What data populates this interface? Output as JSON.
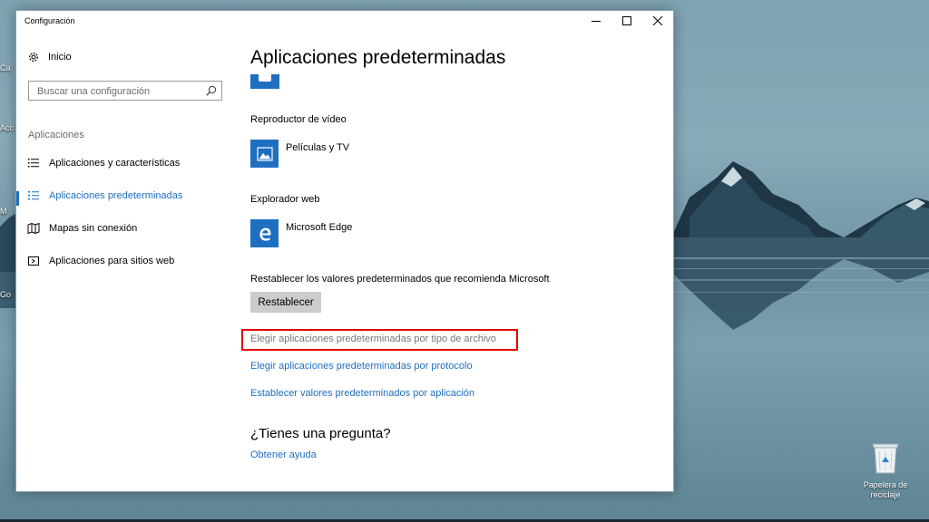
{
  "window": {
    "title": "Configuración"
  },
  "sidebar": {
    "home_label": "Inicio",
    "search_placeholder": "Buscar una configuración",
    "section_label": "Aplicaciones",
    "items": [
      {
        "label": "Aplicaciones y características",
        "icon": "list-icon",
        "selected": false
      },
      {
        "label": "Aplicaciones predeterminadas",
        "icon": "default-apps-icon",
        "selected": true
      },
      {
        "label": "Mapas sin conexión",
        "icon": "map-icon",
        "selected": false
      },
      {
        "label": "Aplicaciones para sitios web",
        "icon": "web-app-icon",
        "selected": false
      }
    ]
  },
  "main": {
    "title": "Aplicaciones predeterminadas",
    "video_player": {
      "label": "Reproductor de vídeo",
      "app": "Películas y TV",
      "icon": "movies-tv-icon"
    },
    "web_browser": {
      "label": "Explorador web",
      "app": "Microsoft Edge",
      "icon": "edge-icon"
    },
    "reset": {
      "label": "Restablecer los valores predeterminados que recomienda Microsoft",
      "button": "Restablecer"
    },
    "links": [
      "Elegir aplicaciones predeterminadas por tipo de archivo",
      "Elegir aplicaciones predeterminadas por protocolo",
      "Establecer valores predeterminados por aplicación"
    ],
    "question": {
      "title": "¿Tienes una pregunta?",
      "link": "Obtener ayuda"
    }
  },
  "desktop": {
    "recycle_bin_label": "Papelera de reciclaje",
    "edge_labels": [
      "Ca",
      "Acc",
      "M",
      "Go"
    ]
  },
  "colors": {
    "accent": "#1f6fc0",
    "highlight": "#e10000"
  }
}
